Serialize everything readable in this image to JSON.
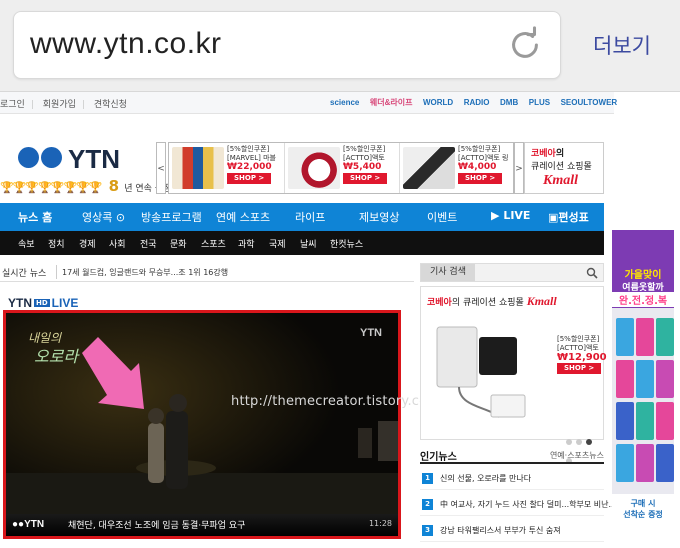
{
  "browser": {
    "url": "www.ytn.co.kr",
    "more_label": "더보기"
  },
  "utility": {
    "left_links": [
      "로그인",
      "회원가입",
      "견학신청"
    ],
    "right_links": [
      "science",
      "웨더&라이프",
      "WORLD",
      "RADIO",
      "DMB",
      "PLUS",
      "SEOULTOWER"
    ]
  },
  "logo": {
    "word": "YTN",
    "award_number": "8",
    "award_text": "년 연속 공정성 1위"
  },
  "ads": [
    {
      "tag": "[5%할인쿠폰]",
      "name": "[MARVEL] 마블",
      "price": "₩22,000",
      "shop": "SHOP >",
      "color": "#d13d2c"
    },
    {
      "tag": "[5%할인쿠폰]",
      "name": "[ACTTO]액토",
      "price": "₩5,400",
      "shop": "SHOP >",
      "color": "#b1162c"
    },
    {
      "tag": "[5%할인쿠폰]",
      "name": "[ACTTO]액토 링",
      "price": "₩4,000",
      "shop": "SHOP >",
      "color": "#7a7a7a"
    }
  ],
  "kmall": {
    "line1_brand": "코베아",
    "line1_rest": "의",
    "line2": "큐레이션 쇼핑몰",
    "logo": "Kmall"
  },
  "nav": {
    "items": [
      "뉴스 홈",
      "영상콕",
      "방송프로그램",
      "연예 스포츠",
      "라이프",
      "제보영상",
      "이벤트",
      "LIVE",
      "편성표"
    ]
  },
  "subnav": {
    "items": [
      "속보",
      "정치",
      "경제",
      "사회",
      "전국",
      "문화",
      "스포츠",
      "과학",
      "국제",
      "날씨",
      "한컷뉴스"
    ]
  },
  "ticker": {
    "label": "실시간 뉴스",
    "text": "17세 월드컵, 잉글랜드와 무승부...조 1위 16강행"
  },
  "search": {
    "label": "기사 검색"
  },
  "live": {
    "ytn": "YTN",
    "hd": "HD",
    "live": "LIVE"
  },
  "video": {
    "bug": "YTN",
    "logo_line1": "내일의",
    "logo_line2": "오로라",
    "logo_line3": "",
    "lower_brand": "●●YTN",
    "lower_news": "채현단, 대우조선 노조에 임금 동결·무파업 요구",
    "time": "11:28"
  },
  "watermark": "http://themecreator.tistory.com/",
  "bigad": {
    "brand": "코베아",
    "text": "의 큐레이션 쇼핑몰",
    "logo": "Kmall",
    "tag": "[5%할인쿠폰]",
    "name": "[ACTTO]액토",
    "price": "₩12,900",
    "shop": "SHOP >"
  },
  "popular": {
    "title": "인기뉴스",
    "sub": "연예·스포츠뉴스",
    "items": [
      {
        "num": "1",
        "title": "신의 선물, 오로라를 만나다"
      },
      {
        "num": "2",
        "title": "中 여교사, 자기 누드 사진 찰다 덜미...학부모 비난..."
      },
      {
        "num": "3",
        "title": "강남 타워팰리스서 부부가 투신 숨져"
      }
    ]
  },
  "sidebanner": {
    "a": "가을맞이",
    "b": "여름옷할까",
    "c": "완.전.정.복",
    "bottom_a": "구매 시",
    "bottom_b": "선착순 증정"
  }
}
